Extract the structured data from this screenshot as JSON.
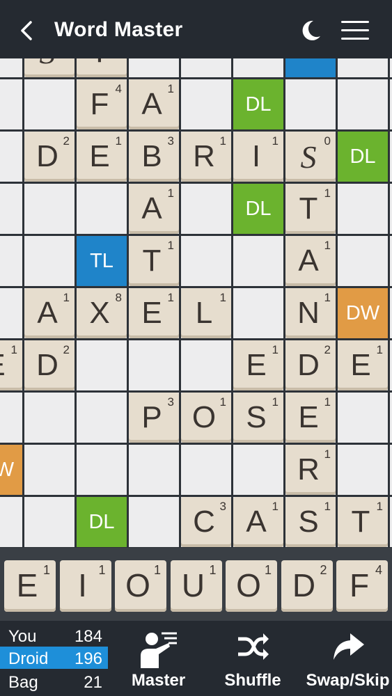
{
  "header": {
    "title": "Word Master",
    "back_icon": "chevron-left-icon",
    "theme_icon": "moon-icon",
    "menu_icon": "hamburger-menu-icon"
  },
  "board": {
    "premiums": [
      {
        "col": 5,
        "row": -1,
        "type": "tl",
        "label": "TL"
      },
      {
        "col": 4,
        "row": 0,
        "type": "dl",
        "label": "DL"
      },
      {
        "col": 6,
        "row": 1,
        "type": "dl",
        "label": "DL"
      },
      {
        "col": 4,
        "row": 2,
        "type": "dl",
        "label": "DL"
      },
      {
        "col": 1,
        "row": 3,
        "type": "tl",
        "label": "TL"
      },
      {
        "col": 6,
        "row": 4,
        "type": "dw",
        "label": "DW"
      },
      {
        "col": -1,
        "row": 7,
        "type": "dw",
        "label": "DW"
      },
      {
        "col": 1,
        "row": 8,
        "type": "dl",
        "label": "DL"
      }
    ],
    "tiles": [
      {
        "col": 0,
        "row": -1,
        "letter": "S",
        "value": "",
        "blank": true
      },
      {
        "col": 1,
        "row": -1,
        "letter": "T",
        "value": ""
      },
      {
        "col": 1,
        "row": 0,
        "letter": "F",
        "value": "4"
      },
      {
        "col": 2,
        "row": 0,
        "letter": "A",
        "value": "1"
      },
      {
        "col": 0,
        "row": 1,
        "letter": "D",
        "value": "2"
      },
      {
        "col": 1,
        "row": 1,
        "letter": "E",
        "value": "1"
      },
      {
        "col": 2,
        "row": 1,
        "letter": "B",
        "value": "3"
      },
      {
        "col": 3,
        "row": 1,
        "letter": "R",
        "value": "1"
      },
      {
        "col": 4,
        "row": 1,
        "letter": "I",
        "value": "1"
      },
      {
        "col": 5,
        "row": 1,
        "letter": "S",
        "value": "0",
        "blank": true
      },
      {
        "col": 2,
        "row": 2,
        "letter": "A",
        "value": "1"
      },
      {
        "col": 5,
        "row": 2,
        "letter": "T",
        "value": "1"
      },
      {
        "col": 2,
        "row": 3,
        "letter": "T",
        "value": "1"
      },
      {
        "col": 5,
        "row": 3,
        "letter": "A",
        "value": "1"
      },
      {
        "col": 0,
        "row": 4,
        "letter": "A",
        "value": "1"
      },
      {
        "col": 1,
        "row": 4,
        "letter": "X",
        "value": "8"
      },
      {
        "col": 2,
        "row": 4,
        "letter": "E",
        "value": "1"
      },
      {
        "col": 3,
        "row": 4,
        "letter": "L",
        "value": "1"
      },
      {
        "col": 5,
        "row": 4,
        "letter": "N",
        "value": "1"
      },
      {
        "col": -1,
        "row": 5,
        "letter": "E",
        "value": "1"
      },
      {
        "col": 0,
        "row": 5,
        "letter": "D",
        "value": "2"
      },
      {
        "col": 4,
        "row": 5,
        "letter": "E",
        "value": "1"
      },
      {
        "col": 5,
        "row": 5,
        "letter": "D",
        "value": "2"
      },
      {
        "col": 6,
        "row": 5,
        "letter": "E",
        "value": "1"
      },
      {
        "col": 2,
        "row": 6,
        "letter": "P",
        "value": "3"
      },
      {
        "col": 3,
        "row": 6,
        "letter": "O",
        "value": "1"
      },
      {
        "col": 4,
        "row": 6,
        "letter": "S",
        "value": "1"
      },
      {
        "col": 5,
        "row": 6,
        "letter": "E",
        "value": "1"
      },
      {
        "col": 5,
        "row": 7,
        "letter": "R",
        "value": "1"
      },
      {
        "col": 3,
        "row": 8,
        "letter": "C",
        "value": "3"
      },
      {
        "col": 4,
        "row": 8,
        "letter": "A",
        "value": "1"
      },
      {
        "col": 5,
        "row": 8,
        "letter": "S",
        "value": "1"
      },
      {
        "col": 6,
        "row": 8,
        "letter": "T",
        "value": "1"
      }
    ]
  },
  "rack": [
    {
      "letter": "E",
      "value": "1"
    },
    {
      "letter": "I",
      "value": "1"
    },
    {
      "letter": "O",
      "value": "1"
    },
    {
      "letter": "U",
      "value": "1"
    },
    {
      "letter": "O",
      "value": "1"
    },
    {
      "letter": "D",
      "value": "2"
    },
    {
      "letter": "F",
      "value": "4"
    }
  ],
  "scores": {
    "you": {
      "name": "You",
      "score": "184"
    },
    "droid": {
      "name": "Droid",
      "score": "196"
    },
    "bag": {
      "name": "Bag",
      "score": "21"
    }
  },
  "actions": {
    "master": {
      "label": "Master",
      "icon": "teacher-icon"
    },
    "shuffle": {
      "label": "Shuffle",
      "icon": "shuffle-icon"
    },
    "swap": {
      "label": "Swap/Skip",
      "icon": "share-arrow-icon"
    }
  },
  "colors": {
    "dl": "#6bb32e",
    "tl": "#1f84c9",
    "dw": "#e19b45",
    "tile": "#e6ddce"
  }
}
